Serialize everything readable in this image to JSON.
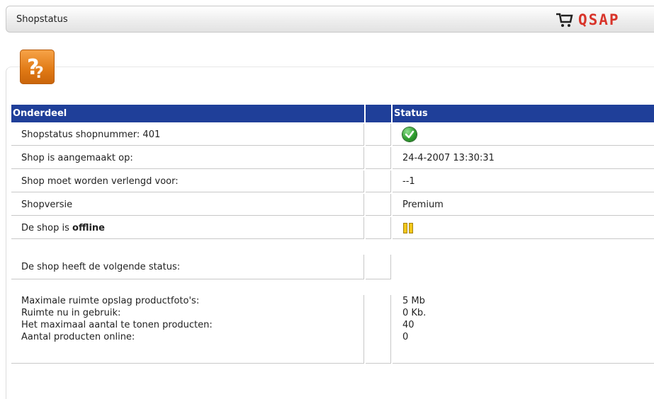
{
  "header": {
    "title": "Shopstatus",
    "logo_text": "QSAP"
  },
  "icons": {
    "help": "help-question-icon",
    "online_status": "check-ok-icon",
    "offline_status": "pause-icon",
    "logo": "cart-icon"
  },
  "colors": {
    "header_bg": "#1f3f99",
    "accent": "#e07914",
    "logo": "#d8342a",
    "ok": "#2f9e2f",
    "pause": "#f3c81b"
  },
  "table": {
    "col_part": "Onderdeel",
    "col_status": "Status",
    "rows": [
      {
        "label": "Shopstatus shopnummer: 401",
        "value": ""
      },
      {
        "label": "Shop is aangemaakt op:",
        "value": "24-4-2007 13:30:31"
      },
      {
        "label": "Shop moet worden verlengd voor:",
        "value": "--1"
      },
      {
        "label": "Shopversie",
        "value": "Premium"
      },
      {
        "label_prefix": "De shop is ",
        "label_bold": "offline",
        "value": ""
      }
    ],
    "status_row_label": "De shop heeft de volgende status:",
    "stats": [
      {
        "label": "Maximale ruimte opslag productfoto's:",
        "value": "5 Mb"
      },
      {
        "label": "Ruimte nu in gebruik:",
        "value": "0 Kb."
      },
      {
        "label": "Het maximaal aantal te tonen producten:",
        "value": "40"
      },
      {
        "label": "Aantal producten online:",
        "value": "0"
      }
    ]
  }
}
